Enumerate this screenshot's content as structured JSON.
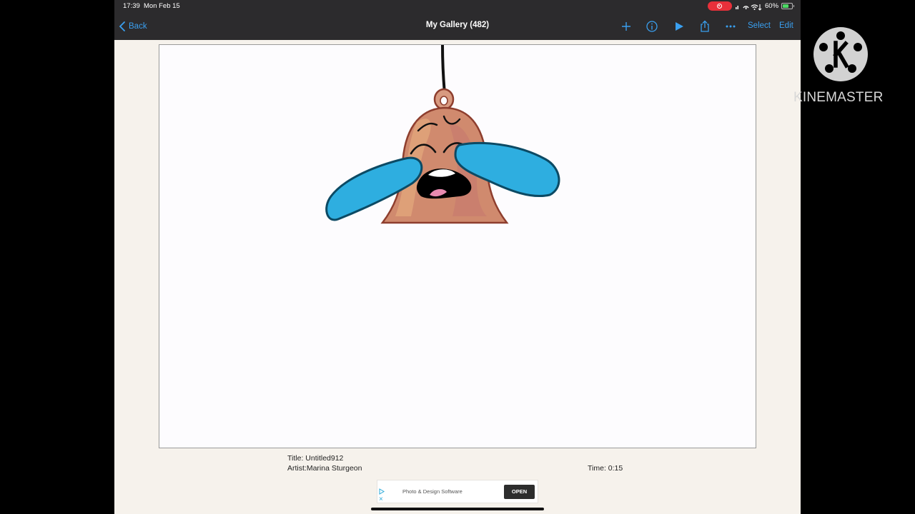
{
  "status_bar": {
    "time": "17:39",
    "date": "Mon Feb 15",
    "battery": "60%",
    "recording_color": "#e8303a"
  },
  "navbar": {
    "back_label": "Back",
    "title": "My Gallery (482)",
    "icons": [
      "plus-icon",
      "info-icon",
      "play-icon",
      "share-icon",
      "more-icon"
    ],
    "select_label": "Select",
    "edit_label": "Edit",
    "accent_color": "#3aa0f0"
  },
  "artwork": {
    "subject": "crying-bell-illustration",
    "colors": {
      "bell": "#d08a6e",
      "outline": "#8e3e2e",
      "tears": "#2eaee0",
      "tear_outline": "#0c4a64"
    }
  },
  "info": {
    "title": "Title: Untitled912",
    "artist": "Artist:Marina Sturgeon",
    "time": "Time:  0:15"
  },
  "ad": {
    "text": "Photo & Design Software",
    "button_label": "OPEN"
  },
  "watermark": {
    "text": "KINEMASTER"
  }
}
